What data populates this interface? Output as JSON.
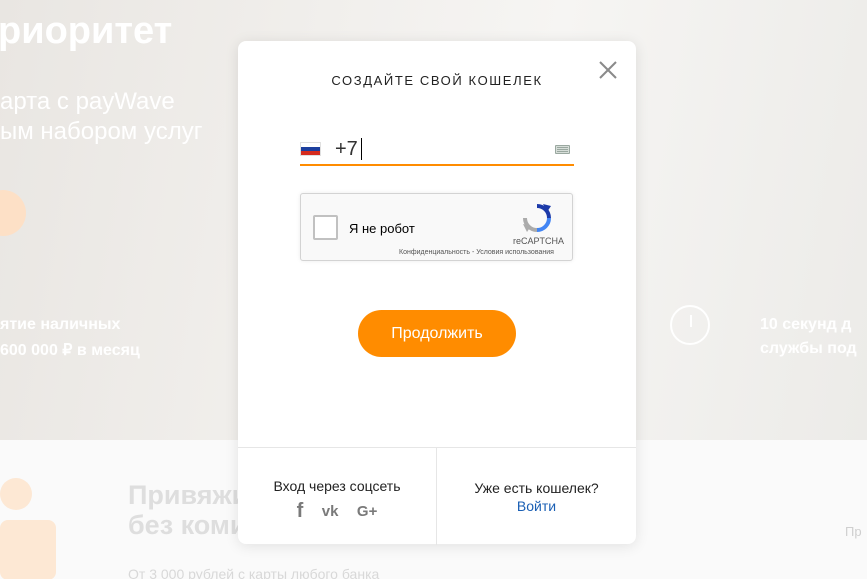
{
  "background": {
    "headline": "риоритет",
    "subline1": "арта с payWave",
    "subline2": "ым набором услуг",
    "feature_left_1": "ятие наличных",
    "feature_left_2": "600 000 ₽ в месяц",
    "feature_right_1": "10 секунд д",
    "feature_right_2": "службы под",
    "lower_title_1": "Привяжи",
    "lower_title_2": "без коми",
    "lower_small": "От 3 000 рублей с карты любого банка",
    "lower_right": "Пр"
  },
  "modal": {
    "title": "СОЗДАЙТЕ СВОЙ КОШЕЛЕК",
    "phone_value": "+7",
    "flag_colors": [
      "#ffffff",
      "#1c3f9e",
      "#d52b1e"
    ],
    "captcha": {
      "label": "Я не робот",
      "brand": "reCAPTCHA",
      "links": "Конфиденциальность - Условия использования"
    },
    "continue_label": "Продолжить",
    "footer": {
      "social_label": "Вход через соцсеть",
      "social_icons": [
        "facebook-icon",
        "vk-icon",
        "google-plus-icon"
      ],
      "facebook_glyph": "f",
      "vk_glyph": "vk",
      "gplus_glyph": "G+",
      "wallet_label": "Уже есть кошелек?",
      "login_label": "Войти"
    }
  },
  "colors": {
    "accent": "#ff8c00",
    "link": "#1a5fb4"
  }
}
